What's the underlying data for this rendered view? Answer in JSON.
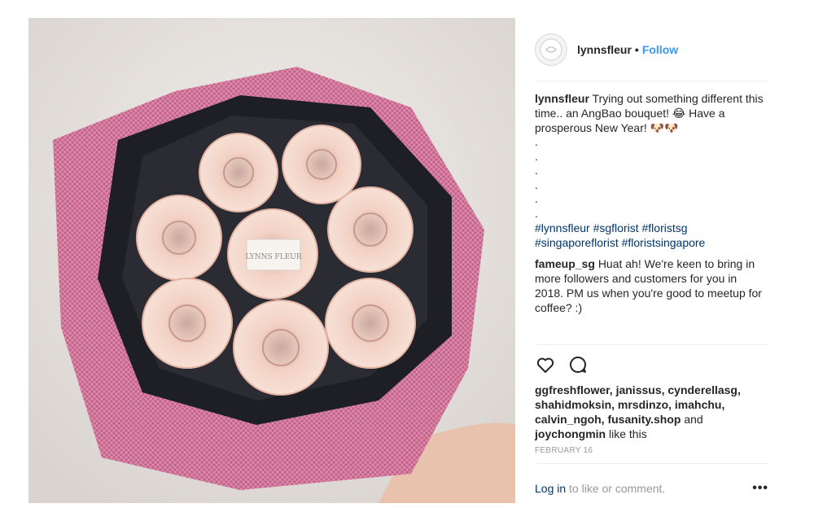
{
  "post": {
    "photo_icon": "bouquet-photo",
    "photo_brand": "LYNNS FLEUR",
    "username": "lynnsfleur",
    "separator": "•",
    "follow_label": "Follow",
    "caption": {
      "user": "lynnsfleur",
      "line1": "Trying out something different this time.. an AngBao bouquet! 😂 Have a prosperous New Year! 🐶🐶",
      "dots": [
        ".",
        ".",
        ".",
        ".",
        ".",
        "."
      ],
      "tags_line1": "#lynnsfleur #sgflorist #floristsg",
      "tags_line2": "#singaporeflorist #floristsingapore"
    },
    "comment": {
      "user": "fameup_sg",
      "text": "Huat ah! We're keen to bring in more followers and customers for you in 2018. PM us when you're good to meetup for coffee? :)"
    },
    "actions": {
      "like_icon": "heart-icon",
      "comment_icon": "comment-icon"
    },
    "likes": {
      "users_line": "ggfreshflower, janissus, cynderellasg, shahidmoksin, mrsdinzo, imahchu, calvin_ngoh, fusanity.shop",
      "and": "and",
      "last_user": "joychongmin",
      "suffix": "like this"
    },
    "date": "FEBRUARY 16",
    "footer": {
      "login_label": "Log in",
      "rest_label": "to like or comment.",
      "more_label": "•••"
    }
  },
  "colors": {
    "link_blue": "#3897f0",
    "hashtag": "#003569",
    "muted": "#999999"
  }
}
